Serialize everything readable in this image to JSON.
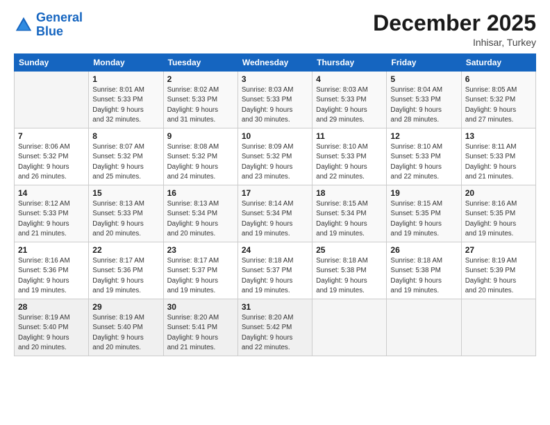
{
  "logo": {
    "line1": "General",
    "line2": "Blue"
  },
  "title": "December 2025",
  "subtitle": "Inhisar, Turkey",
  "days_of_week": [
    "Sunday",
    "Monday",
    "Tuesday",
    "Wednesday",
    "Thursday",
    "Friday",
    "Saturday"
  ],
  "weeks": [
    [
      {
        "day": "",
        "info": ""
      },
      {
        "day": "1",
        "info": "Sunrise: 8:01 AM\nSunset: 5:33 PM\nDaylight: 9 hours\nand 32 minutes."
      },
      {
        "day": "2",
        "info": "Sunrise: 8:02 AM\nSunset: 5:33 PM\nDaylight: 9 hours\nand 31 minutes."
      },
      {
        "day": "3",
        "info": "Sunrise: 8:03 AM\nSunset: 5:33 PM\nDaylight: 9 hours\nand 30 minutes."
      },
      {
        "day": "4",
        "info": "Sunrise: 8:03 AM\nSunset: 5:33 PM\nDaylight: 9 hours\nand 29 minutes."
      },
      {
        "day": "5",
        "info": "Sunrise: 8:04 AM\nSunset: 5:33 PM\nDaylight: 9 hours\nand 28 minutes."
      },
      {
        "day": "6",
        "info": "Sunrise: 8:05 AM\nSunset: 5:32 PM\nDaylight: 9 hours\nand 27 minutes."
      }
    ],
    [
      {
        "day": "7",
        "info": "Sunrise: 8:06 AM\nSunset: 5:32 PM\nDaylight: 9 hours\nand 26 minutes."
      },
      {
        "day": "8",
        "info": "Sunrise: 8:07 AM\nSunset: 5:32 PM\nDaylight: 9 hours\nand 25 minutes."
      },
      {
        "day": "9",
        "info": "Sunrise: 8:08 AM\nSunset: 5:32 PM\nDaylight: 9 hours\nand 24 minutes."
      },
      {
        "day": "10",
        "info": "Sunrise: 8:09 AM\nSunset: 5:32 PM\nDaylight: 9 hours\nand 23 minutes."
      },
      {
        "day": "11",
        "info": "Sunrise: 8:10 AM\nSunset: 5:33 PM\nDaylight: 9 hours\nand 22 minutes."
      },
      {
        "day": "12",
        "info": "Sunrise: 8:10 AM\nSunset: 5:33 PM\nDaylight: 9 hours\nand 22 minutes."
      },
      {
        "day": "13",
        "info": "Sunrise: 8:11 AM\nSunset: 5:33 PM\nDaylight: 9 hours\nand 21 minutes."
      }
    ],
    [
      {
        "day": "14",
        "info": "Sunrise: 8:12 AM\nSunset: 5:33 PM\nDaylight: 9 hours\nand 21 minutes."
      },
      {
        "day": "15",
        "info": "Sunrise: 8:13 AM\nSunset: 5:33 PM\nDaylight: 9 hours\nand 20 minutes."
      },
      {
        "day": "16",
        "info": "Sunrise: 8:13 AM\nSunset: 5:34 PM\nDaylight: 9 hours\nand 20 minutes."
      },
      {
        "day": "17",
        "info": "Sunrise: 8:14 AM\nSunset: 5:34 PM\nDaylight: 9 hours\nand 19 minutes."
      },
      {
        "day": "18",
        "info": "Sunrise: 8:15 AM\nSunset: 5:34 PM\nDaylight: 9 hours\nand 19 minutes."
      },
      {
        "day": "19",
        "info": "Sunrise: 8:15 AM\nSunset: 5:35 PM\nDaylight: 9 hours\nand 19 minutes."
      },
      {
        "day": "20",
        "info": "Sunrise: 8:16 AM\nSunset: 5:35 PM\nDaylight: 9 hours\nand 19 minutes."
      }
    ],
    [
      {
        "day": "21",
        "info": "Sunrise: 8:16 AM\nSunset: 5:36 PM\nDaylight: 9 hours\nand 19 minutes."
      },
      {
        "day": "22",
        "info": "Sunrise: 8:17 AM\nSunset: 5:36 PM\nDaylight: 9 hours\nand 19 minutes."
      },
      {
        "day": "23",
        "info": "Sunrise: 8:17 AM\nSunset: 5:37 PM\nDaylight: 9 hours\nand 19 minutes."
      },
      {
        "day": "24",
        "info": "Sunrise: 8:18 AM\nSunset: 5:37 PM\nDaylight: 9 hours\nand 19 minutes."
      },
      {
        "day": "25",
        "info": "Sunrise: 8:18 AM\nSunset: 5:38 PM\nDaylight: 9 hours\nand 19 minutes."
      },
      {
        "day": "26",
        "info": "Sunrise: 8:18 AM\nSunset: 5:38 PM\nDaylight: 9 hours\nand 19 minutes."
      },
      {
        "day": "27",
        "info": "Sunrise: 8:19 AM\nSunset: 5:39 PM\nDaylight: 9 hours\nand 20 minutes."
      }
    ],
    [
      {
        "day": "28",
        "info": "Sunrise: 8:19 AM\nSunset: 5:40 PM\nDaylight: 9 hours\nand 20 minutes."
      },
      {
        "day": "29",
        "info": "Sunrise: 8:19 AM\nSunset: 5:40 PM\nDaylight: 9 hours\nand 20 minutes."
      },
      {
        "day": "30",
        "info": "Sunrise: 8:20 AM\nSunset: 5:41 PM\nDaylight: 9 hours\nand 21 minutes."
      },
      {
        "day": "31",
        "info": "Sunrise: 8:20 AM\nSunset: 5:42 PM\nDaylight: 9 hours\nand 22 minutes."
      },
      {
        "day": "",
        "info": ""
      },
      {
        "day": "",
        "info": ""
      },
      {
        "day": "",
        "info": ""
      }
    ]
  ]
}
